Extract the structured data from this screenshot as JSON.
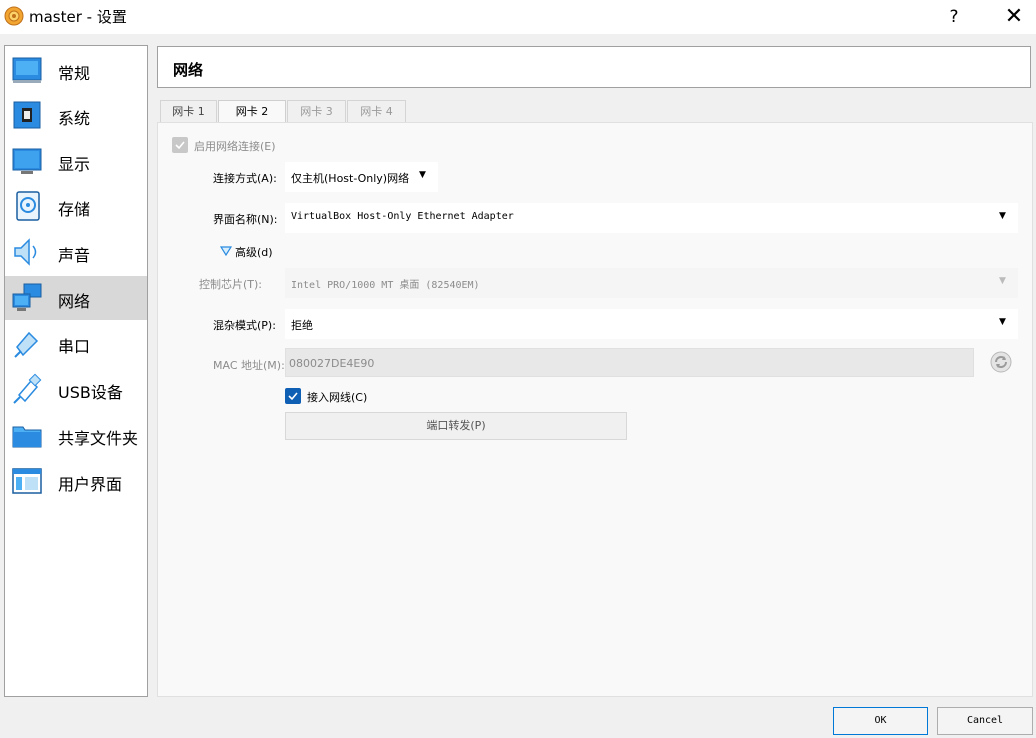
{
  "window": {
    "title": "master - 设置",
    "help_label": "?",
    "close_label": "✕"
  },
  "sidebar": {
    "items": [
      {
        "label": "常规",
        "icon": "general-icon"
      },
      {
        "label": "系统",
        "icon": "system-chip-icon"
      },
      {
        "label": "显示",
        "icon": "monitor-icon"
      },
      {
        "label": "存储",
        "icon": "storage-disk-icon"
      },
      {
        "label": "声音",
        "icon": "speaker-icon"
      },
      {
        "label": "网络",
        "icon": "network-icon",
        "active": true
      },
      {
        "label": "串口",
        "icon": "serial-port-icon"
      },
      {
        "label": "USB设备",
        "icon": "usb-icon"
      },
      {
        "label": "共享文件夹",
        "icon": "shared-folder-icon"
      },
      {
        "label": "用户界面",
        "icon": "user-interface-icon"
      }
    ]
  },
  "header": {
    "title": "网络"
  },
  "tabs": [
    {
      "label": "网卡 1",
      "state": "normal"
    },
    {
      "label": "网卡 2",
      "state": "active"
    },
    {
      "label": "网卡 3",
      "state": "disabled"
    },
    {
      "label": "网卡 4",
      "state": "disabled"
    }
  ],
  "form": {
    "enable_label": "启用网络连接(E)",
    "enable_checked": true,
    "attached_label": "连接方式(A):",
    "attached_value": "仅主机(Host-Only)网络",
    "name_label": "界面名称(N):",
    "name_value": "VirtualBox Host-Only Ethernet Adapter",
    "advanced_label": "高级(d)",
    "adapter_label": "控制芯片(T):",
    "adapter_value": "Intel PRO/1000 MT 桌面 (82540EM)",
    "promisc_label": "混杂模式(P):",
    "promisc_value": "拒绝",
    "mac_label": "MAC 地址(M):",
    "mac_value": "080027DE4E90",
    "cable_label": "接入网线(C)",
    "cable_checked": true,
    "port_forward_label": "端口转发(P)"
  },
  "buttons": {
    "ok": "OK",
    "cancel": "Cancel"
  },
  "colors": {
    "accent": "#0f5fb5",
    "active_sidebar": "#d8d8d8"
  }
}
